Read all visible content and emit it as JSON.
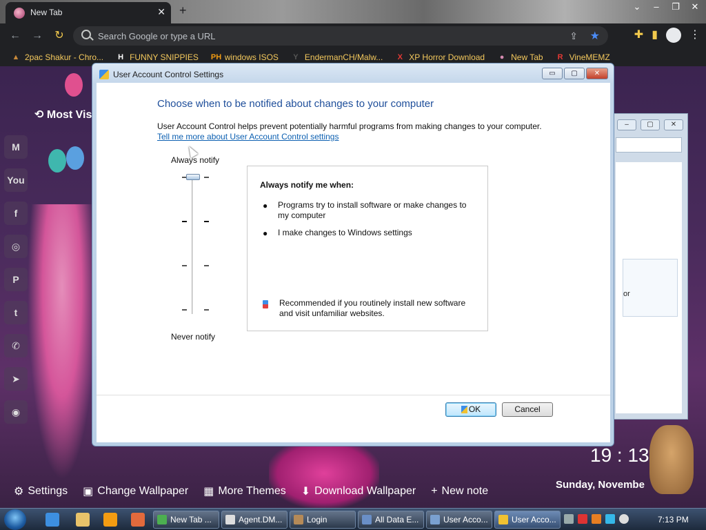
{
  "browser": {
    "tab_title": "New Tab",
    "tab_close": "✕",
    "new_tab": "+",
    "omnibox_placeholder": "Search Google or type a URL",
    "bookmarks": [
      {
        "label": "2pac Shakur - Chro...",
        "icon": "bookmark-2pac-icon",
        "color": "#c8893a",
        "glyph": "▲"
      },
      {
        "label": "FUNNY SNIPPIES",
        "icon": "bookmark-h-icon",
        "color": "#ffffff",
        "glyph": "H"
      },
      {
        "label": "windows ISOS",
        "icon": "bookmark-ph-icon",
        "color": "#f39c12",
        "glyph": "PH"
      },
      {
        "label": "EndermanCH/Malw...",
        "icon": "bookmark-yp-icon",
        "color": "#555555",
        "glyph": "Y"
      },
      {
        "label": "XP Horror Download",
        "icon": "bookmark-x-icon",
        "color": "#e53935",
        "glyph": "X"
      },
      {
        "label": "New Tab",
        "icon": "bookmark-newtab-icon",
        "color": "#d48ab0",
        "glyph": "●"
      },
      {
        "label": "VineMEMZ",
        "icon": "bookmark-r-icon",
        "color": "#e53935",
        "glyph": "R"
      }
    ]
  },
  "wallpaper": {
    "most_visited": "Most Vis",
    "clock": "19 : 13",
    "date": "Sunday, Novembe",
    "bottom_items": [
      {
        "label": "Settings",
        "icon": "gear-icon",
        "glyph": "⚙"
      },
      {
        "label": "Change Wallpaper",
        "icon": "image-icon",
        "glyph": "▣"
      },
      {
        "label": "More Themes",
        "icon": "grid-icon",
        "glyph": "▦"
      },
      {
        "label": "Download Wallpaper",
        "icon": "download-icon",
        "glyph": "⬇"
      },
      {
        "label": "New note",
        "icon": "plus-icon",
        "glyph": "+"
      }
    ],
    "social": [
      {
        "name": "gmail-icon",
        "glyph": "M"
      },
      {
        "name": "youtube-icon",
        "glyph": "You"
      },
      {
        "name": "facebook-icon",
        "glyph": "f"
      },
      {
        "name": "instagram-icon",
        "glyph": "◎"
      },
      {
        "name": "pinterest-icon",
        "glyph": "P"
      },
      {
        "name": "twitter-icon",
        "glyph": "t"
      },
      {
        "name": "whatsapp-icon",
        "glyph": "✆"
      },
      {
        "name": "telegram-icon",
        "glyph": "➤"
      },
      {
        "name": "reddit-icon",
        "glyph": "◉"
      }
    ]
  },
  "back_window": {
    "snippet": "or"
  },
  "dialog": {
    "title": "User Account Control Settings",
    "min": "▭",
    "max": "▢",
    "close": "✕",
    "heading": "Choose when to be notified about changes to your computer",
    "description": "User Account Control helps prevent potentially harmful programs from making changes to your computer.",
    "learn_more": "Tell me more about User Account Control settings",
    "always_notify": "Always notify",
    "never_notify": "Never notify",
    "slider_level": 4,
    "slider_levels_total": 4,
    "info_title": "Always notify me when:",
    "bullets": [
      "Programs try to install software or make changes to my computer",
      "I make changes to Windows settings"
    ],
    "recommendation": "Recommended if you routinely install new software and visit unfamiliar websites.",
    "ok": "OK",
    "cancel": "Cancel"
  },
  "taskbar": {
    "tasks": [
      {
        "label": "New Tab ...",
        "icon": "chrome-icon",
        "color": "#4caf50"
      },
      {
        "label": "Agent.DM...",
        "icon": "window-icon",
        "color": "#dddddd"
      },
      {
        "label": "Login",
        "icon": "login-icon",
        "color": "#b58a58"
      },
      {
        "label": "All Data E...",
        "icon": "notepad-icon",
        "color": "#6a8fc7"
      },
      {
        "label": "User Acco...",
        "icon": "uac-icon",
        "color": "#7aa0d0"
      },
      {
        "label": "User Acco...",
        "icon": "uac-shield-icon",
        "color": "#f1c232"
      }
    ],
    "time": "7:13 PM"
  }
}
